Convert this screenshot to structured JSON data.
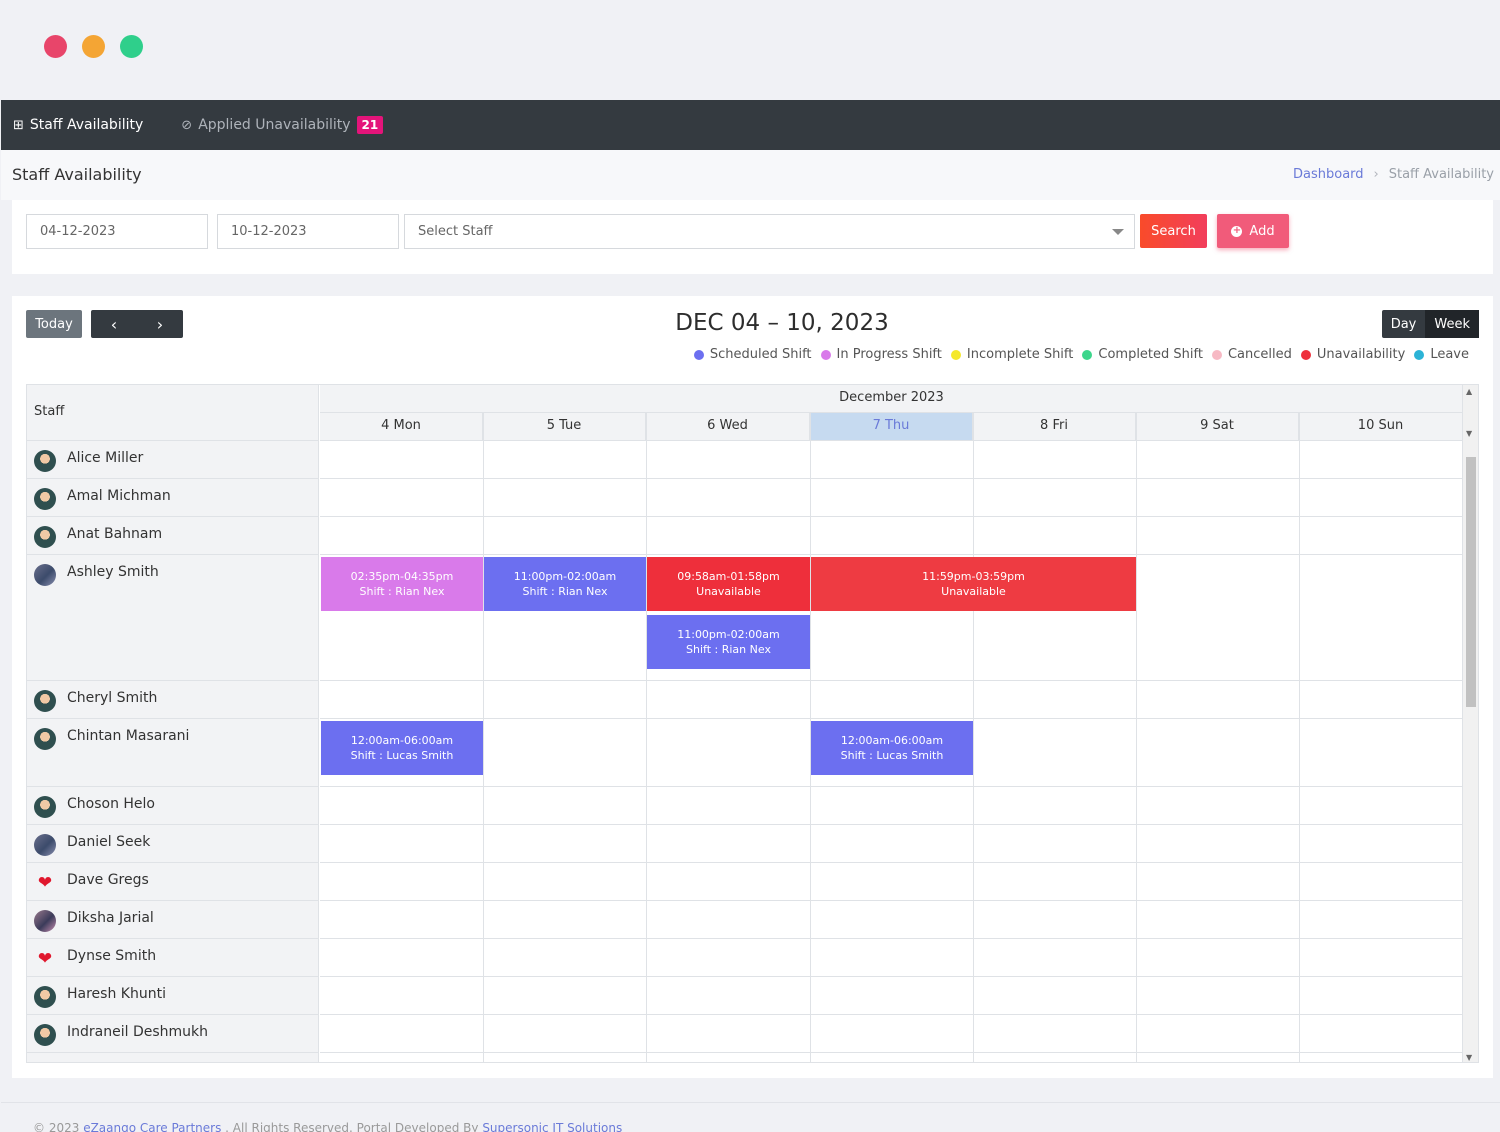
{
  "window": {
    "dot_colors": [
      "#e8456a",
      "#f4a534",
      "#2fcf8b"
    ]
  },
  "nav": {
    "tabs": [
      {
        "label": "Staff Availability",
        "icon": "grid-icon"
      },
      {
        "label": "Applied Unavailability",
        "icon": "check-circle-icon",
        "badge": "21"
      }
    ]
  },
  "header": {
    "title": "Staff Availability",
    "breadcrumb": {
      "home": "Dashboard",
      "separator": "›",
      "current": "Staff Availability"
    }
  },
  "filters": {
    "from_date": "04-12-2023",
    "to_date": "10-12-2023",
    "staff_placeholder": "Select Staff",
    "search_label": "Search",
    "add_label": "Add"
  },
  "calendar": {
    "today_label": "Today",
    "prev_icon": "‹",
    "next_icon": "›",
    "title": "DEC 04 – 10, 2023",
    "views": [
      "Day",
      "Week"
    ],
    "active_view": "Week",
    "legend": [
      {
        "label": "Scheduled Shift",
        "color": "#6c6ff0"
      },
      {
        "label": "In Progress Shift",
        "color": "#d97aea"
      },
      {
        "label": "Incomplete Shift",
        "color": "#f5e82a"
      },
      {
        "label": "Completed Shift",
        "color": "#3dd68c"
      },
      {
        "label": "Cancelled",
        "color": "#f7b9c4"
      },
      {
        "label": "Unavailability",
        "color": "#ee2f3b"
      },
      {
        "label": "Leave",
        "color": "#2cb3d6"
      }
    ],
    "staff_header": "Staff",
    "month_label": "December 2023",
    "days": [
      "4 Mon",
      "5 Tue",
      "6 Wed",
      "7 Thu",
      "8 Fri",
      "9 Sat",
      "10 Sun"
    ],
    "today_index": 3,
    "staff": [
      {
        "name": "Alice Miller",
        "avatar": "face"
      },
      {
        "name": "Amal Michman",
        "avatar": "face"
      },
      {
        "name": "Anat Bahnam",
        "avatar": "face"
      },
      {
        "name": "Ashley Smith",
        "avatar": "photo"
      },
      {
        "name": "Cheryl Smith",
        "avatar": "face"
      },
      {
        "name": "Chintan Masarani",
        "avatar": "face"
      },
      {
        "name": "Choson Helo",
        "avatar": "face"
      },
      {
        "name": "Daniel Seek",
        "avatar": "photo"
      },
      {
        "name": "Dave Gregs",
        "avatar": "heart"
      },
      {
        "name": "Diksha Jarial",
        "avatar": "photo2"
      },
      {
        "name": "Dynse Smith",
        "avatar": "heart"
      },
      {
        "name": "Haresh Khunti",
        "avatar": "face"
      },
      {
        "name": "Indraneil Deshmukh",
        "avatar": "face"
      }
    ],
    "events": [
      {
        "staff": 3,
        "day": 0,
        "span": 1,
        "slot": 0,
        "time": "02:35pm-04:35pm",
        "text": "Shift : Rian Nex",
        "color": "#d97aea"
      },
      {
        "staff": 3,
        "day": 1,
        "span": 1,
        "slot": 0,
        "time": "11:00pm-02:00am",
        "text": "Shift : Rian Nex",
        "color": "#6c6ff0"
      },
      {
        "staff": 3,
        "day": 2,
        "span": 1,
        "slot": 0,
        "time": "09:58am-01:58pm",
        "text": "Unavailable",
        "color": "#ee2f3b"
      },
      {
        "staff": 3,
        "day": 3,
        "span": 2,
        "slot": 0,
        "time": "11:59pm-03:59pm",
        "text": "Unavailable",
        "color": "#ee3b42"
      },
      {
        "staff": 3,
        "day": 2,
        "span": 1,
        "slot": 1,
        "time": "11:00pm-02:00am",
        "text": "Shift : Rian Nex",
        "color": "#6c6ff0"
      },
      {
        "staff": 5,
        "day": 0,
        "span": 1,
        "slot": 0,
        "time": "12:00am-06:00am",
        "text": "Shift : Lucas Smith",
        "color": "#6c6ff0"
      },
      {
        "staff": 5,
        "day": 3,
        "span": 1,
        "slot": 0,
        "time": "12:00am-06:00am",
        "text": "Shift : Lucas Smith",
        "color": "#6c6ff0"
      }
    ]
  },
  "footer": {
    "copyright": "© 2023",
    "company": "eZaango Care Partners",
    "rights": ". All Rights Reserved. Portal Developed By",
    "developer": "Supersonic IT Solutions"
  }
}
